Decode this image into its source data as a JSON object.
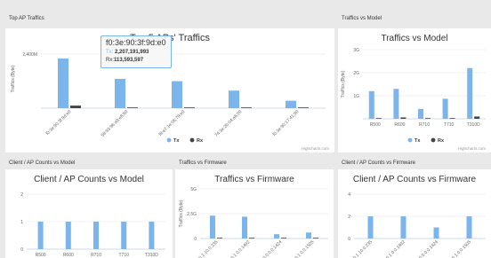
{
  "panels": {
    "top_ap_traffics": "Top AP Traffics",
    "traffics_vs_model": "Traffics vs Model",
    "client_ap_counts_vs_model": "Client / AP Counts vs Model",
    "traffics_vs_firmware": "Traffics vs Firmware",
    "client_ap_counts_vs_firmware": "Client / AP Counts vs Firmware"
  },
  "tooltip": {
    "category": "f0:3e:90:3f:9d:e0",
    "tx_label": "Tx:",
    "tx_value": "2,207,191,993",
    "rx_label": "Rx:",
    "rx_value": "113,593,597"
  },
  "colors": {
    "tx": "#7cb5ec",
    "rx": "#434348",
    "grid": "#e6e6e6",
    "credits": "#999999"
  },
  "chart_data": [
    {
      "id": "top5",
      "type": "bar",
      "title": "Top 5 APs' Traffics",
      "ylabel": "Traffics (Byte)",
      "yticks": [
        "2,400M"
      ],
      "ylim": [
        0,
        2600000000
      ],
      "categories": [
        "f0:3e:90:3f:9d:e0",
        "58:93:96:a9:e8:60",
        "f8:e7:1e:06:79:e0",
        "74:3e:2b:04:a6:00",
        "f0:3e:90:17:41:90"
      ],
      "series": [
        {
          "name": "Tx",
          "values": [
            2207191993,
            1300000000,
            1200000000,
            780000000,
            330000000
          ]
        },
        {
          "name": "Rx",
          "values": [
            113593597,
            20000000,
            10000000,
            10000000,
            10000000
          ]
        }
      ],
      "legend": [
        "Tx",
        "Rx"
      ],
      "credits": "Highcharts.com"
    },
    {
      "id": "model",
      "type": "bar",
      "title": "Traffics vs Model",
      "ylabel": "Traffics (Byte)",
      "yticks": [
        "3G",
        "2G",
        "1G"
      ],
      "ylim": [
        0,
        3000000000
      ],
      "categories": [
        "R500",
        "R600",
        "R710",
        "T710",
        "T310D"
      ],
      "series": [
        {
          "name": "Tx",
          "values": [
            1200000000,
            1300000000,
            430000000,
            870000000,
            2200000000
          ]
        },
        {
          "name": "Rx",
          "values": [
            30000000,
            60000000,
            20000000,
            30000000,
            100000000
          ]
        }
      ],
      "legend": [
        "Tx",
        "Rx"
      ],
      "credits": "Highcharts.com"
    },
    {
      "id": "clientmodel",
      "type": "bar",
      "title": "Client / AP Counts vs Model",
      "ylabel": "",
      "yticks": [
        "2",
        "1",
        "0"
      ],
      "ylim": [
        0,
        2
      ],
      "categories": [
        "R500",
        "R600",
        "R710",
        "T710",
        "T310D"
      ],
      "series": [
        {
          "name": "AP",
          "values": [
            1,
            1,
            1,
            1,
            1
          ]
        }
      ]
    },
    {
      "id": "firmware",
      "type": "bar",
      "title": "Traffics vs Firmware",
      "ylabel": "Traffics (Byte)",
      "yticks": [
        "5G",
        "2.5G",
        "0"
      ],
      "ylim": [
        0,
        5000000000
      ],
      "categories": [
        "200.1.10.0.235",
        "10.1.0.0.1492",
        "10.0.0.0.1424",
        "10.1.0.0.1505"
      ],
      "series": [
        {
          "name": "Tx",
          "values": [
            2300000000,
            2200000000,
            430000000,
            600000000
          ]
        },
        {
          "name": "Rx",
          "values": [
            30000000,
            60000000,
            20000000,
            40000000
          ]
        }
      ]
    },
    {
      "id": "clientfirmware",
      "type": "bar",
      "title": "Client / AP Counts vs Firmware",
      "ylabel": "",
      "yticks": [
        "4",
        "2",
        "0"
      ],
      "ylim": [
        0,
        4
      ],
      "categories": [
        "200.1.10.0.235",
        "10.1.0.0.1492",
        "10.0.0.0.1424",
        "10.1.0.0.1505"
      ],
      "series": [
        {
          "name": "AP",
          "values": [
            2,
            2,
            1,
            2
          ]
        }
      ]
    }
  ]
}
